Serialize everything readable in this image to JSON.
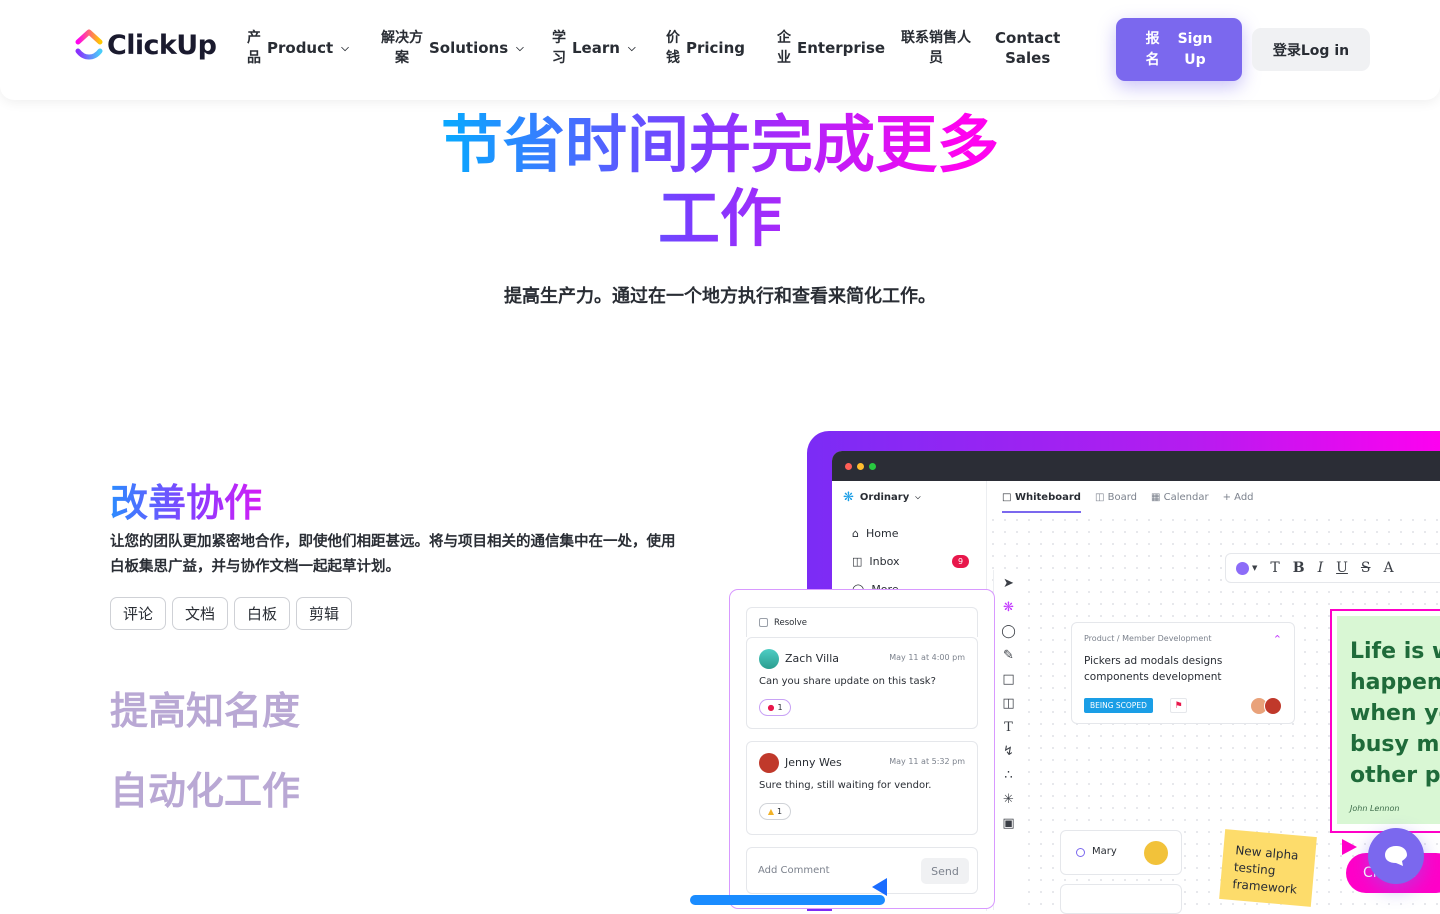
{
  "nav": {
    "logo_text": "ClickUp",
    "items": [
      {
        "cn": "产\n品",
        "en": "Product",
        "has_chevron": true
      },
      {
        "cn": "解决方\n案",
        "en": "Solutions",
        "has_chevron": true
      },
      {
        "cn": "学\n习",
        "en": "Learn",
        "has_chevron": true
      },
      {
        "cn": "价\n钱",
        "en": "Pricing",
        "has_chevron": false
      },
      {
        "cn": "企\n业",
        "en": "Enterprise",
        "has_chevron": false
      }
    ],
    "contact_cn": "联系销售人\n员",
    "contact_en": "Contact\nSales",
    "signup_cn": "报\n名",
    "signup_en": "Sign\nUp",
    "login": "登录Log in"
  },
  "hero": {
    "title": "节省时间并完成更多工作",
    "subtitle": "提高生产力。通过在一个地方执行和查看来简化工作。"
  },
  "features": {
    "active_title": "改善协作",
    "active_desc": "让您的团队更加紧密地合作，即使他们相距甚远。将与项目相关的通信集中在一处，使用白板集思广益，并与协作文档一起起草计划。",
    "chips": [
      "评论",
      "文档",
      "白板",
      "剪辑"
    ],
    "other_titles": [
      "提高知名度",
      "自动化工作"
    ]
  },
  "app": {
    "workspace": "Ordinary",
    "sidebar": [
      {
        "label": "Home",
        "icon": "home-icon"
      },
      {
        "label": "Inbox",
        "icon": "inbox-icon",
        "badge": "9"
      },
      {
        "label": "More",
        "icon": "more-icon"
      }
    ],
    "tabs": [
      {
        "label": "Whiteboard",
        "icon": "whiteboard-icon",
        "active": true
      },
      {
        "label": "Board",
        "icon": "board-icon"
      },
      {
        "label": "Calendar",
        "icon": "calendar-icon"
      },
      {
        "label": "+ Add",
        "icon": "plus-icon"
      }
    ],
    "format_toolbar": [
      "T",
      "B",
      "I",
      "U",
      "S",
      "A"
    ],
    "task_card": {
      "breadcrumb": "Product  /  Member Development",
      "title": "Pickers ad modals designs components development",
      "status": "BEING SCOPED"
    },
    "quote": {
      "lines": [
        "Life is wh",
        "happens",
        "when yo",
        "busy ma",
        "other pla"
      ],
      "author": "John Lennon"
    },
    "mary_card": {
      "name": "Mary"
    },
    "sticky_note": "New alpha testing framework",
    "cursor_pill": "Ch    ng c",
    "comments_panel": {
      "resolve_label": "Resolve",
      "comments": [
        {
          "name": "Zach Villa",
          "time": "May 11 at 4:00 pm",
          "body": "Can you share update on this task?",
          "reaction": "1"
        },
        {
          "name": "Jenny Wes",
          "time": "May 11 at 5:32 pm",
          "body": "Sure thing, still waiting for vendor.",
          "reaction": "1"
        }
      ],
      "add_placeholder": "Add Comment",
      "send_label": "Send"
    }
  },
  "colors": {
    "brand_purple": "#7b68ee",
    "hero_gradient": [
      "#0aa7ff",
      "#7b3cff",
      "#ff02f0"
    ],
    "magenta": "#ff00c8"
  }
}
